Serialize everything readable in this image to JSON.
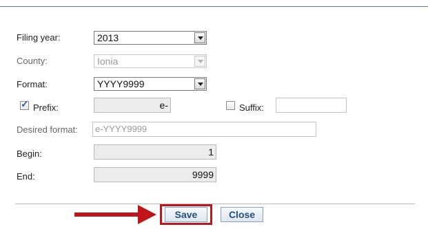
{
  "form": {
    "filing_year": {
      "label": "Filing year:",
      "value": "2013"
    },
    "county": {
      "label": "County:",
      "value": "Ionia"
    },
    "format": {
      "label": "Format:",
      "value": "YYYY9999"
    },
    "prefix": {
      "label": "Prefix:",
      "checked": true,
      "value": "e-"
    },
    "suffix": {
      "label": "Suffix:",
      "checked": false,
      "value": ""
    },
    "desired_format": {
      "label": "Desired format:",
      "value": "e-YYYY9999"
    },
    "begin": {
      "label": "Begin:",
      "value": "1"
    },
    "end": {
      "label": "End:",
      "value": "9999"
    }
  },
  "buttons": {
    "save": "Save",
    "close": "Close"
  },
  "colors": {
    "highlight": "#c0141b",
    "arrow": "#c0141b",
    "button_text": "#1f4d86"
  },
  "icons": {
    "checkbox_tick": "✓"
  }
}
